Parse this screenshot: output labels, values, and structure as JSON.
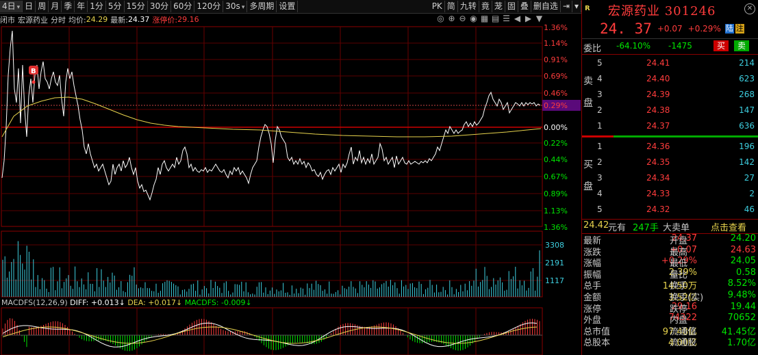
{
  "toolbar": {
    "items": [
      "4日",
      "日",
      "周",
      "月",
      "季",
      "年",
      "1分",
      "5分",
      "15分",
      "30分",
      "60分",
      "120分",
      "30s",
      "多周期",
      "设置"
    ],
    "right_items": [
      "PK",
      "简",
      "九转",
      "竟",
      "茏",
      "固",
      "叠",
      "删自选"
    ]
  },
  "infobar": {
    "status": "闭市",
    "stock": "宏源药业",
    "period": "分时",
    "avg_label": "均价:",
    "avg_value": "24.29",
    "last_label": "最新:",
    "last_value": "24.37",
    "limit_label": "涨停价:",
    "limit_value": "29.16"
  },
  "price_axis": {
    "up": [
      "1.36%",
      "1.14%",
      "0.91%",
      "0.69%",
      "0.46%",
      "0.29%"
    ],
    "zero": "0.00%",
    "down": [
      "0.22%",
      "0.44%",
      "0.67%",
      "0.89%",
      "1.13%",
      "1.36%"
    ]
  },
  "volume_axis": [
    "3308",
    "2191",
    "1117"
  ],
  "macd": {
    "label": "MACDFS(12,26,9)",
    "diff": "DIFF: +0.013↓",
    "dea": "DEA: +0.017↓",
    "macdfs": "MACDFS: -0.009↓"
  },
  "marker": "B",
  "side": {
    "r_badge": "R",
    "title": "宏源药业 301246",
    "price": "24. 37",
    "change": "+0.07",
    "change_pct": "+0.29%",
    "badge1": "陆",
    "badge2": "注",
    "weibi_label": "委比",
    "weibi_pct": "-64.10%",
    "weibi_diff": "-1475",
    "buy_btn": "买",
    "sell_btn": "卖",
    "sell_label": [
      "卖",
      "盘"
    ],
    "buy_label": [
      "买",
      "盘"
    ],
    "asks": [
      {
        "lv": "5",
        "price": "24.41",
        "vol": "214"
      },
      {
        "lv": "4",
        "price": "24.40",
        "vol": "623"
      },
      {
        "lv": "3",
        "price": "24.39",
        "vol": "268"
      },
      {
        "lv": "2",
        "price": "24.38",
        "vol": "147"
      },
      {
        "lv": "1",
        "price": "24.37",
        "vol": "636"
      }
    ],
    "bids": [
      {
        "lv": "1",
        "price": "24.36",
        "vol": "196"
      },
      {
        "lv": "2",
        "price": "24.35",
        "vol": "142"
      },
      {
        "lv": "3",
        "price": "24.34",
        "vol": "27"
      },
      {
        "lv": "4",
        "price": "24.33",
        "vol": "2"
      },
      {
        "lv": "5",
        "price": "24.32",
        "vol": "46"
      }
    ],
    "tick": {
      "price": "24.42",
      "unit": "元有",
      "vol": "247手",
      "type": "大卖单",
      "link": "点击查看"
    },
    "stats": [
      [
        "最新",
        "24.37",
        "开盘",
        "24.20"
      ],
      [
        "涨跌",
        "+0.07",
        "最高",
        "24.63"
      ],
      [
        "涨幅",
        "+0.29%",
        "最低",
        "24.05"
      ],
      [
        "振幅",
        "2.39%",
        "量比",
        "0.58"
      ],
      [
        "总手",
        "14.50万",
        "换手",
        "8.52%"
      ],
      [
        "金额",
        "3.52亿",
        "换手(实)",
        "9.48%"
      ],
      [
        "涨停",
        "29.16",
        "跌停",
        "19.44"
      ],
      [
        "外盘",
        "74322",
        "内盘",
        "70652"
      ],
      [
        "总市值",
        "97.48亿",
        "流通值",
        "41.45亿"
      ],
      [
        "总股本",
        "4.00亿",
        "流通股",
        "1.70亿"
      ]
    ]
  },
  "colors": {
    "up": "#ff3c3c",
    "down": "#00e600",
    "grid": "#8b0000",
    "price_line": "#ffffff",
    "avg_line": "#e8d44d"
  }
}
